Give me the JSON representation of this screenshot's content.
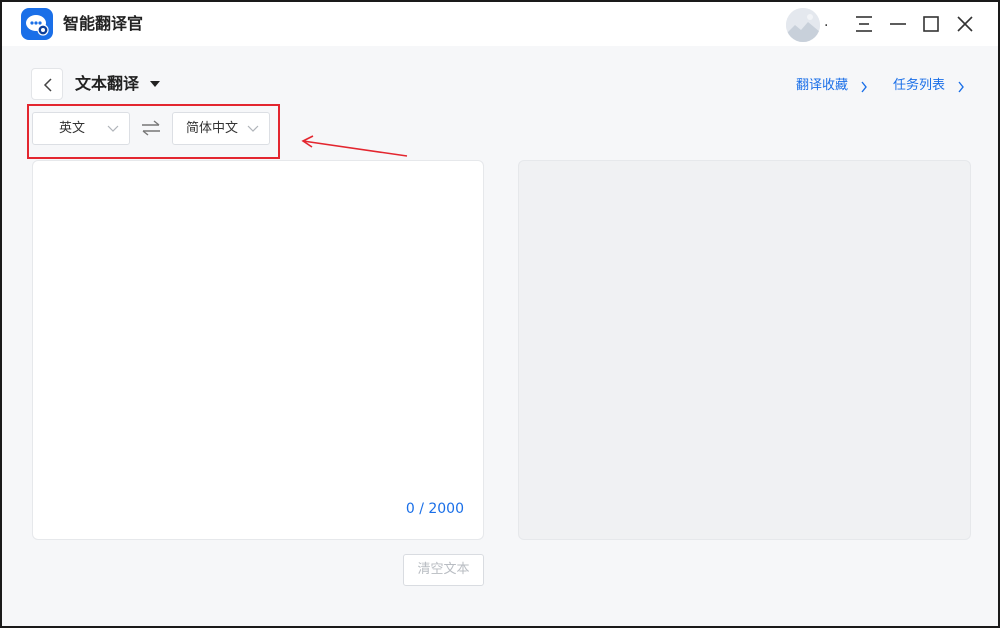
{
  "app": {
    "title": "智能翻译官"
  },
  "user": {
    "name": "."
  },
  "header": {
    "title": "文本翻译",
    "link_favorites": "翻译收藏",
    "link_tasks": "任务列表"
  },
  "languages": {
    "source": "英文",
    "target": "简体中文"
  },
  "editor": {
    "value": "",
    "counter": "0 / 2000"
  },
  "actions": {
    "clear_label": "清空文本"
  },
  "colors": {
    "accent": "#1a6fe8",
    "annotation": "#e3262f"
  },
  "icons": [
    "app-logo-icon",
    "avatar",
    "menu-icon",
    "minimize-icon",
    "maximize-icon",
    "close-icon",
    "back-chevron-icon",
    "caret-down-icon",
    "chevron-right-icon",
    "chevron-down-icon",
    "swap-icon"
  ]
}
